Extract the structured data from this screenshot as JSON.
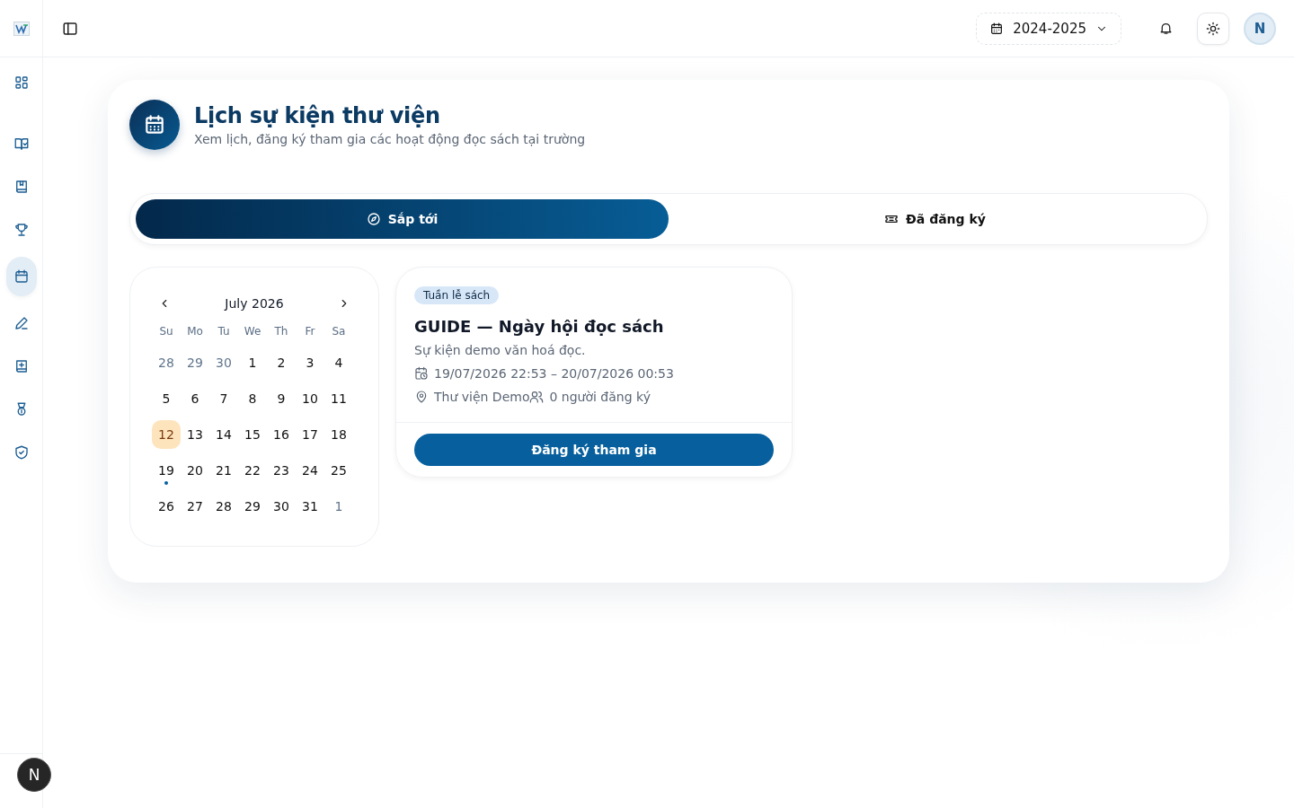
{
  "sidebar": {
    "items": [
      {
        "kind": "grid",
        "selected": false
      },
      {
        "kind": "book-check",
        "selected": false
      },
      {
        "kind": "bookmark-book",
        "selected": false
      },
      {
        "kind": "trophy",
        "selected": false
      },
      {
        "kind": "calendar",
        "selected": true
      },
      {
        "kind": "pen",
        "selected": false
      },
      {
        "kind": "book-plus",
        "selected": false
      },
      {
        "kind": "medal",
        "selected": false
      },
      {
        "kind": "shield",
        "selected": false
      }
    ],
    "dev_badge": "N"
  },
  "topbar": {
    "year_select": "2024-2025",
    "avatar": "N"
  },
  "header": {
    "title": "Lịch sự kiện thư viện",
    "subtitle": "Xem lịch, đăng ký tham gia các hoạt động đọc sách tại trường"
  },
  "tabs": [
    {
      "label": "Sắp tới",
      "kind": "compass",
      "selected": true
    },
    {
      "label": "Đã đăng ký",
      "kind": "ticket",
      "selected": false
    }
  ],
  "calendar": {
    "month": "July 2026",
    "weekdays": [
      "Su",
      "Mo",
      "Tu",
      "We",
      "Th",
      "Fr",
      "Sa"
    ],
    "weeks": [
      [
        {
          "d": "28",
          "muted": true,
          "selected": false,
          "event": false
        },
        {
          "d": "29",
          "muted": true,
          "selected": false,
          "event": false
        },
        {
          "d": "30",
          "muted": true,
          "selected": false,
          "event": false
        },
        {
          "d": "1",
          "muted": false,
          "selected": false,
          "event": false
        },
        {
          "d": "2",
          "muted": false,
          "selected": false,
          "event": false
        },
        {
          "d": "3",
          "muted": false,
          "selected": false,
          "event": false
        },
        {
          "d": "4",
          "muted": false,
          "selected": false,
          "event": false
        }
      ],
      [
        {
          "d": "5",
          "muted": false,
          "selected": false,
          "event": false
        },
        {
          "d": "6",
          "muted": false,
          "selected": false,
          "event": false
        },
        {
          "d": "7",
          "muted": false,
          "selected": false,
          "event": false
        },
        {
          "d": "8",
          "muted": false,
          "selected": false,
          "event": false
        },
        {
          "d": "9",
          "muted": false,
          "selected": false,
          "event": false
        },
        {
          "d": "10",
          "muted": false,
          "selected": false,
          "event": false
        },
        {
          "d": "11",
          "muted": false,
          "selected": false,
          "event": false
        }
      ],
      [
        {
          "d": "12",
          "muted": false,
          "selected": true,
          "event": false
        },
        {
          "d": "13",
          "muted": false,
          "selected": false,
          "event": false
        },
        {
          "d": "14",
          "muted": false,
          "selected": false,
          "event": false
        },
        {
          "d": "15",
          "muted": false,
          "selected": false,
          "event": false
        },
        {
          "d": "16",
          "muted": false,
          "selected": false,
          "event": false
        },
        {
          "d": "17",
          "muted": false,
          "selected": false,
          "event": false
        },
        {
          "d": "18",
          "muted": false,
          "selected": false,
          "event": false
        }
      ],
      [
        {
          "d": "19",
          "muted": false,
          "selected": false,
          "event": true
        },
        {
          "d": "20",
          "muted": false,
          "selected": false,
          "event": false
        },
        {
          "d": "21",
          "muted": false,
          "selected": false,
          "event": false
        },
        {
          "d": "22",
          "muted": false,
          "selected": false,
          "event": false
        },
        {
          "d": "23",
          "muted": false,
          "selected": false,
          "event": false
        },
        {
          "d": "24",
          "muted": false,
          "selected": false,
          "event": false
        },
        {
          "d": "25",
          "muted": false,
          "selected": false,
          "event": false
        }
      ],
      [
        {
          "d": "26",
          "muted": false,
          "selected": false,
          "event": false
        },
        {
          "d": "27",
          "muted": false,
          "selected": false,
          "event": false
        },
        {
          "d": "28",
          "muted": false,
          "selected": false,
          "event": false
        },
        {
          "d": "29",
          "muted": false,
          "selected": false,
          "event": false
        },
        {
          "d": "30",
          "muted": false,
          "selected": false,
          "event": false
        },
        {
          "d": "31",
          "muted": false,
          "selected": false,
          "event": false
        },
        {
          "d": "1",
          "muted": true,
          "selected": false,
          "event": false
        }
      ]
    ]
  },
  "events": [
    {
      "tag": "Tuần lễ sách",
      "title": "GUIDE — Ngày hội đọc sách",
      "description": "Sự kiện demo văn hoá đọc.",
      "time": "19/07/2026 22:53 – 20/07/2026 00:53",
      "location": "Thư viện Demo",
      "attendees": "0 người đăng ký",
      "button": "Đăng ký tham gia"
    }
  ]
}
